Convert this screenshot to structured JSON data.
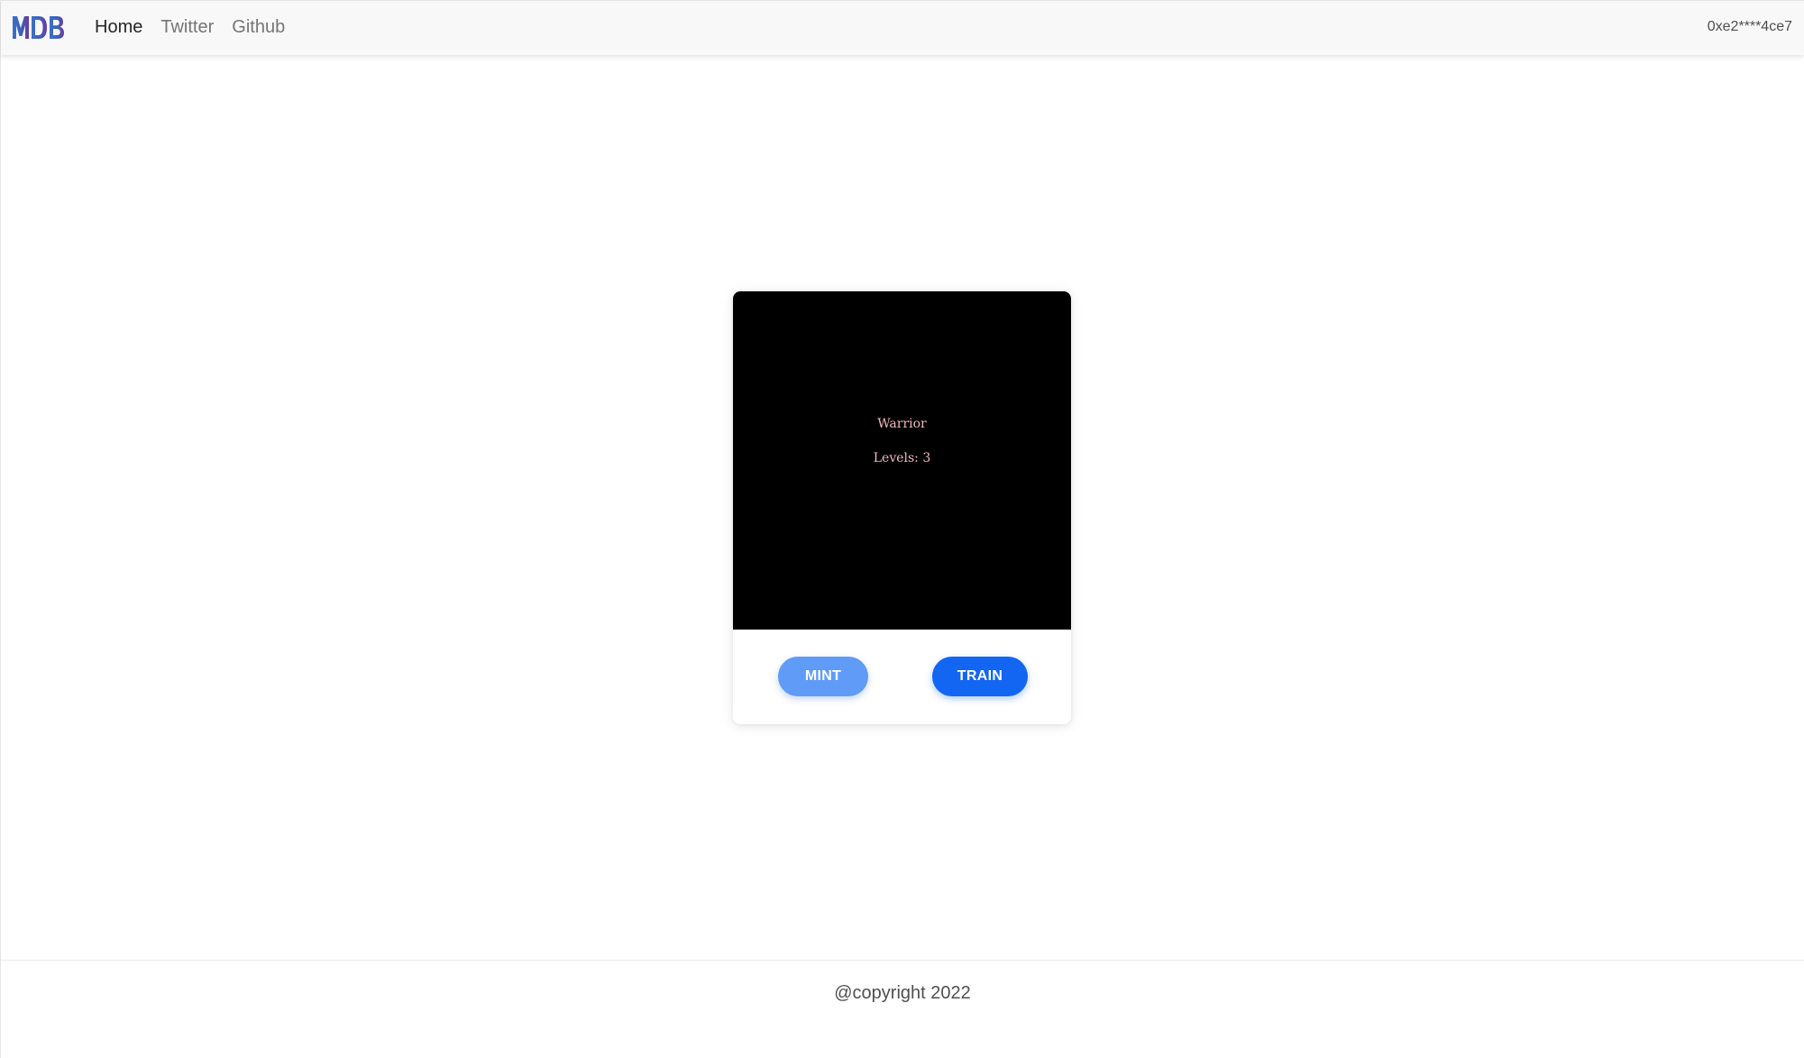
{
  "navbar": {
    "brand": "MDB",
    "links": [
      {
        "label": "Home",
        "active": true
      },
      {
        "label": "Twitter",
        "active": false
      },
      {
        "label": "Github",
        "active": false
      }
    ],
    "account": "0xe2****4ce7"
  },
  "card": {
    "class_name": "Warrior",
    "levels_text": "Levels: 3",
    "mint_label": "MINT",
    "train_label": "TRAIN"
  },
  "footer": {
    "copyright": "@copyright 2022"
  },
  "colors": {
    "primary": "#1266f1",
    "primary_light": "#5f9bf7",
    "navbar_bg": "#f8f8f8",
    "nft_text": "#f2b8c0"
  }
}
